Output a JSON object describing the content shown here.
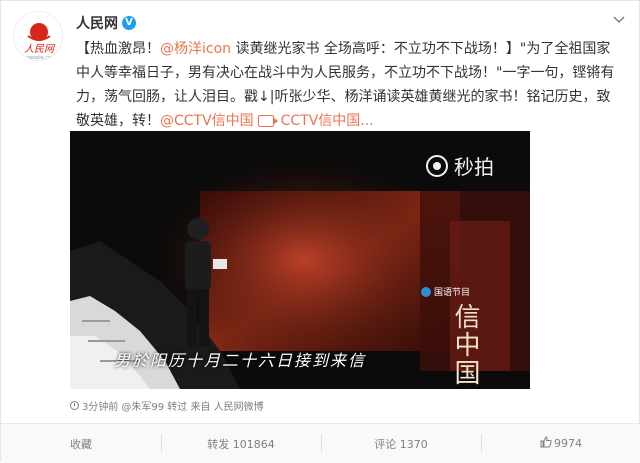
{
  "header": {
    "account_name": "人民网",
    "verified_mark": "V",
    "more_icon": "chevron-down-icon"
  },
  "avatar": {
    "logo_text": "人民网",
    "logo_subtext": "people.cn"
  },
  "post": {
    "part1": "【热血激昂！",
    "mention_yangyang": "@杨洋icon",
    "part2": " 读黄继光家书 全场高呼：不立功不下战场！】\"为了全祖国家中人等幸福日子，男有决心在战斗中为人民服务，不立功不下战场！\"一字一句，铿锵有力，荡气回肠，让人泪目。戳↓|听张少华、杨洋诵读英雄黄继光的家书！铭记历史，致敬英雄，转！",
    "mention_cctv": "@CCTV信中国",
    "video_link": "CCTV信中国..."
  },
  "video": {
    "watermark": "秒拍",
    "subtitle": "男於阳历十月二十六日接到来信",
    "channel_label": "国语节目",
    "calligraphy": "信中国"
  },
  "meta": {
    "time": "3分钟前",
    "via": "@朱军99 转过 来自 人民网微博"
  },
  "actions": {
    "favorite": "收藏",
    "repost": "转发 101864",
    "comment": "评论 1370",
    "like": "9974"
  },
  "colors": {
    "link": "#eb7350",
    "verified": "#1e9df1",
    "text": "#333333",
    "muted": "#808080"
  }
}
